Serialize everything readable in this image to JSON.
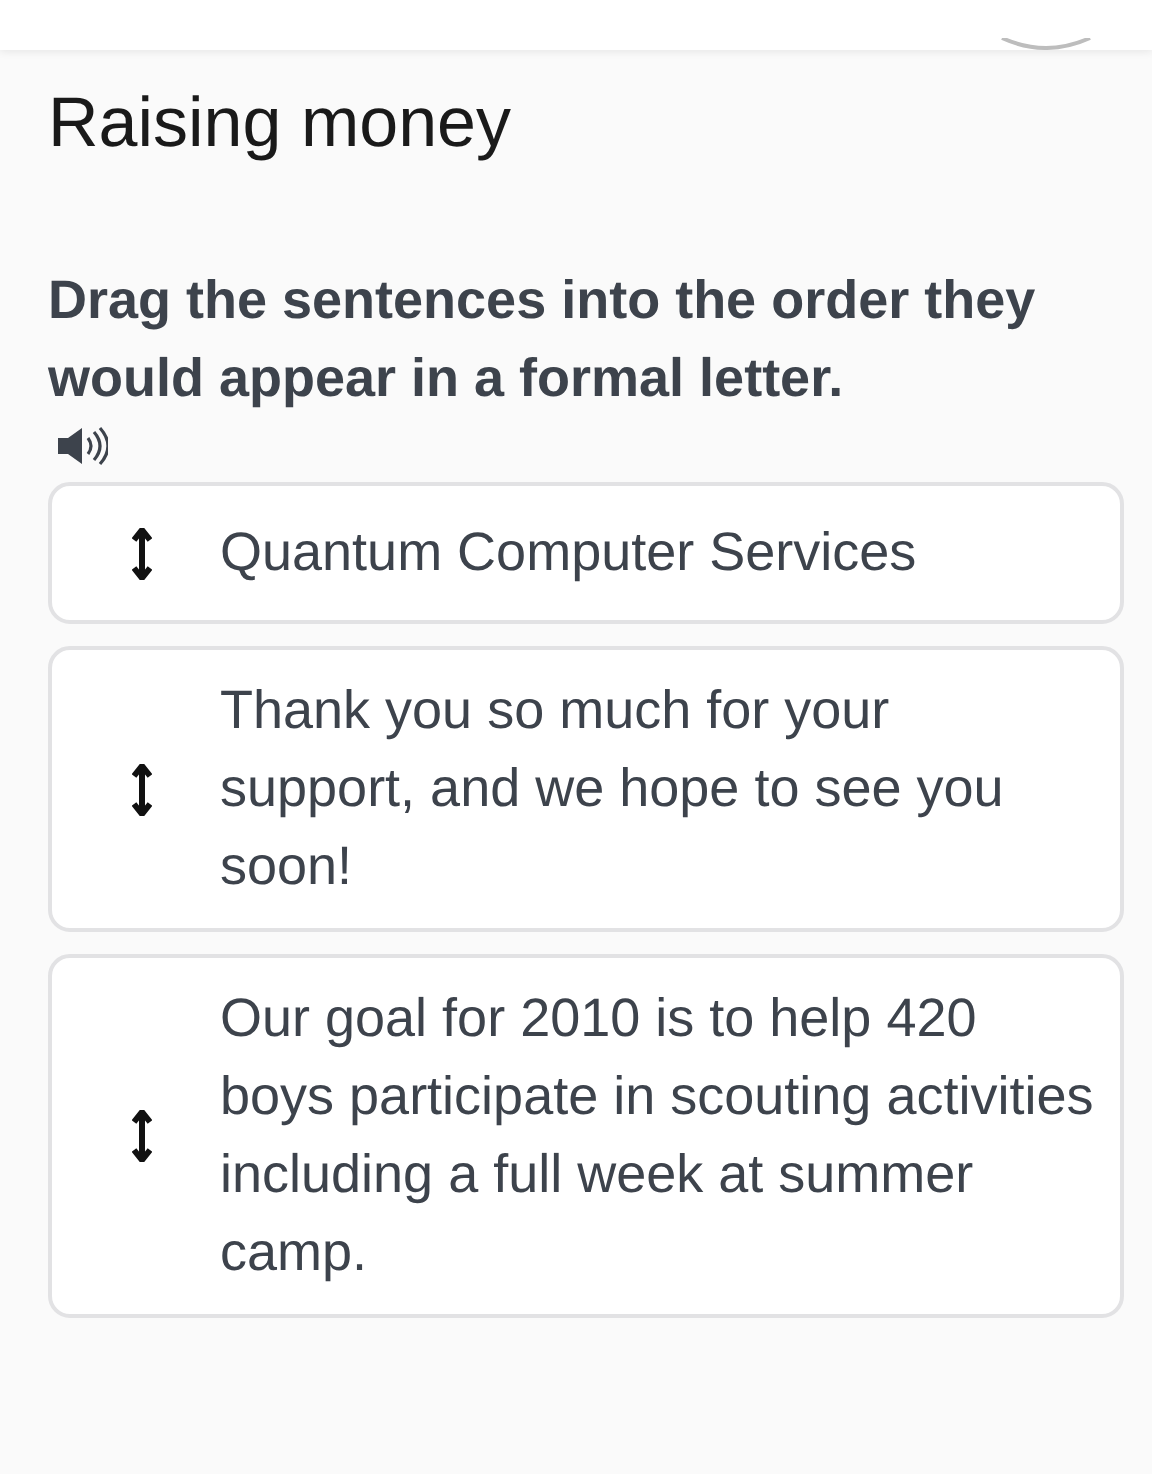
{
  "title": "Raising money",
  "instruction": "Drag the sentences into the order they would appear in a formal letter.",
  "items": [
    {
      "text": "Quantum Computer Services"
    },
    {
      "text": "Thank you so much for your support, and we hope to see you soon!"
    },
    {
      "text": "Our goal for 2010 is to help 420 boys participate in scouting activities including a full week at summer camp."
    }
  ]
}
